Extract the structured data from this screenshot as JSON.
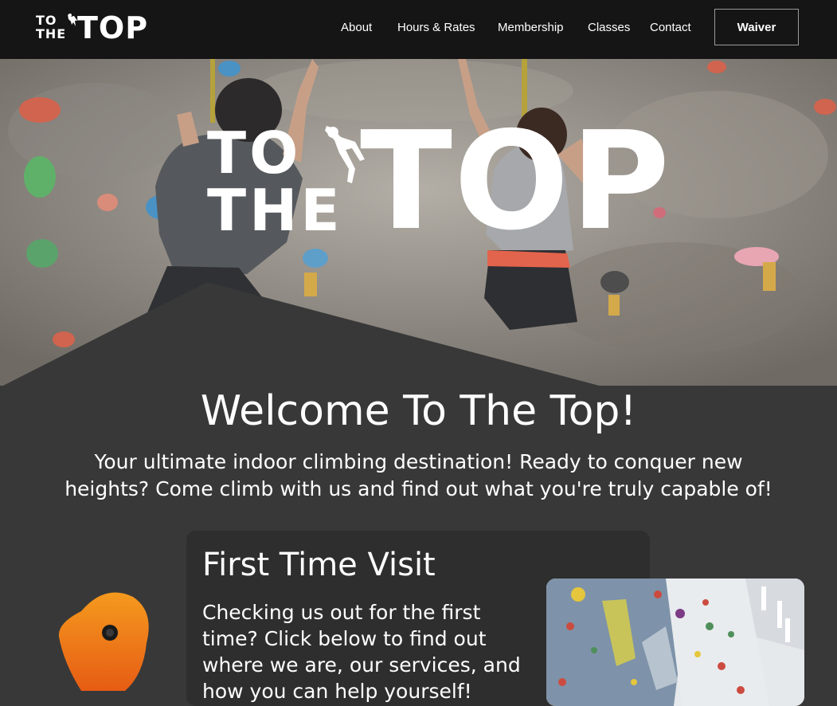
{
  "nav": {
    "logo": {
      "small_top": "TO",
      "small_bottom": "THE",
      "big": "TOP"
    },
    "links": [
      {
        "label": "About"
      },
      {
        "label": "Hours & Rates"
      },
      {
        "label": "Membership"
      },
      {
        "label": "Classes"
      },
      {
        "label": "Contact"
      }
    ],
    "waiver_label": "Waiver"
  },
  "hero": {
    "logo": {
      "line1": "TO",
      "line2": "THE",
      "big": "TOP"
    }
  },
  "welcome": {
    "title": "Welcome To The Top!",
    "subtitle": "Your ultimate indoor climbing destination! Ready to conquer new heights? Come climb with us and find out what you're truly capable of!"
  },
  "first_visit": {
    "title": "First Time Visit",
    "text": "Checking us out for the first time? Click below to find out where we are, our services, and how you can help yourself!"
  },
  "colors": {
    "navbar_bg": "#151515",
    "page_bg": "#383838",
    "card_bg": "#2e2e2e",
    "accent_orange": "#ee7a14"
  },
  "icons": {
    "climber": "climber-icon",
    "hold": "climbing-hold-icon"
  }
}
